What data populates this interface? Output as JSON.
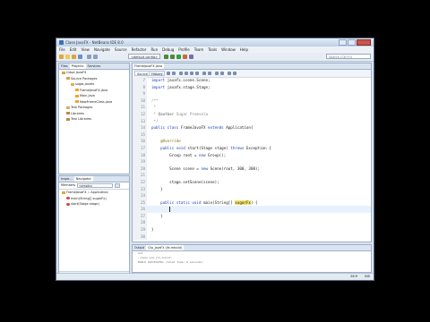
{
  "window": {
    "title": "Clase JavaFX - NetBeans IDE 8.0"
  },
  "menubar": {
    "items": [
      "File",
      "Edit",
      "View",
      "Navigate",
      "Source",
      "Refactor",
      "Run",
      "Debug",
      "Profile",
      "Team",
      "Tools",
      "Window",
      "Help"
    ]
  },
  "toolbar": {
    "config_value": "<default config>",
    "search_placeholder": "Search (Ctrl+I)"
  },
  "projects_panel": {
    "tabs": [
      "Files",
      "Projects",
      "Services"
    ],
    "tree": [
      {
        "label": "Clase JavaFX",
        "depth": 0
      },
      {
        "label": "Source Packages",
        "depth": 1
      },
      {
        "label": "sugar.javafx",
        "depth": 2
      },
      {
        "label": "FrameJavaFX.java",
        "depth": 3
      },
      {
        "label": "Main.java",
        "depth": 3
      },
      {
        "label": "NewFrameClass.java",
        "depth": 3
      },
      {
        "label": "Test Packages",
        "depth": 1
      },
      {
        "label": "Libraries",
        "depth": 1
      },
      {
        "label": "Test Libraries",
        "depth": 1
      }
    ]
  },
  "navigator_panel": {
    "tabs": [
      "Inspe...",
      "Navigator"
    ],
    "members_label": "Members",
    "members_filter": "<empty>",
    "tree": [
      {
        "label": "FrameJavaFX :: Application",
        "depth": 0
      },
      {
        "label": "main(String[] sugarFx)",
        "depth": 1
      },
      {
        "label": "start(Stage stage)",
        "depth": 1
      }
    ]
  },
  "editor": {
    "file_tab": "FrameJavaFX.java",
    "source_tab": "Source",
    "history_tab": "History",
    "lines": [
      {
        "n": "7",
        "tokens": [
          [
            "kw",
            "import "
          ],
          [
            "",
            "javafx.scene.Scene;"
          ]
        ]
      },
      {
        "n": "8",
        "tokens": [
          [
            "kw",
            "import "
          ],
          [
            "",
            "javafx.stage.Stage;"
          ]
        ]
      },
      {
        "n": "9",
        "tokens": []
      },
      {
        "n": "10",
        "tokens": [
          [
            "cm",
            "/**"
          ]
        ]
      },
      {
        "n": "11",
        "tokens": [
          [
            "cm",
            " *"
          ]
        ]
      },
      {
        "n": "12",
        "tokens": [
          [
            "cm",
            " * "
          ],
          [
            "cm-tag",
            "@author"
          ],
          [
            "cm",
            " Sugar Promsela"
          ]
        ]
      },
      {
        "n": "13",
        "tokens": [
          [
            "cm",
            " */"
          ]
        ]
      },
      {
        "n": "14",
        "tokens": [
          [
            "kw",
            "public class "
          ],
          [
            "",
            "FrameJavaFX "
          ],
          [
            "kw",
            "extends "
          ],
          [
            "",
            "Application{"
          ]
        ]
      },
      {
        "n": "15",
        "tokens": []
      },
      {
        "n": "16",
        "tokens": [
          [
            "an",
            "    @Override"
          ]
        ]
      },
      {
        "n": "17",
        "tokens": [
          [
            "kw",
            "    public void "
          ],
          [
            "",
            "start(Stage stage) "
          ],
          [
            "kw",
            "throws "
          ],
          [
            "",
            "Exception {"
          ]
        ]
      },
      {
        "n": "18",
        "tokens": [
          [
            "",
            "        Group root = "
          ],
          [
            "kw",
            "new "
          ],
          [
            "",
            "Group();"
          ]
        ]
      },
      {
        "n": "19",
        "tokens": []
      },
      {
        "n": "20",
        "tokens": [
          [
            "",
            "        Scene scene = "
          ],
          [
            "kw",
            "new "
          ],
          [
            "",
            "Scene(root, 300, 300);"
          ]
        ]
      },
      {
        "n": "21",
        "tokens": []
      },
      {
        "n": "22",
        "tokens": [
          [
            "",
            "        stage.setScene(scene);"
          ]
        ]
      },
      {
        "n": "23",
        "tokens": [
          [
            "",
            "    }"
          ]
        ]
      },
      {
        "n": "24",
        "tokens": []
      },
      {
        "n": "25",
        "tokens": [
          [
            "kw",
            "    public static void "
          ],
          [
            "",
            "main(String[] "
          ],
          [
            "hl",
            "sugarFx"
          ],
          [
            "",
            ") {"
          ]
        ]
      },
      {
        "n": "26",
        "tokens": [
          [
            "",
            "        "
          ],
          [
            "caret",
            ""
          ]
        ]
      },
      {
        "n": "27",
        "tokens": [
          [
            "",
            "    }"
          ]
        ]
      },
      {
        "n": "28",
        "tokens": []
      },
      {
        "n": "29",
        "tokens": [
          [
            "",
            "}"
          ]
        ]
      },
      {
        "n": "30",
        "tokens": []
      }
    ]
  },
  "output_panel": {
    "tabs": [
      "Output",
      "Clip_JavaFX (jfx-rebuild)"
    ],
    "lines": [
      "ant",
      "-clean-pre-jfx-build:",
      "BUILD SUCCESSFUL (total time: 0 seconds)"
    ]
  },
  "statusbar": {
    "position": "26:9",
    "mode": "INS"
  }
}
